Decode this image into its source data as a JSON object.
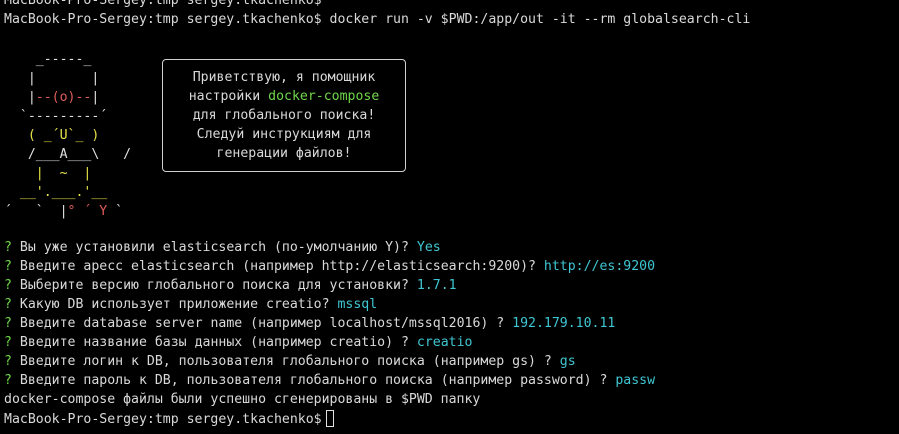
{
  "terminal": {
    "top_prompt": "MacBook-Pro-Sergey:tmp sergey.tkachenko$",
    "command_prompt": "MacBook-Pro-Sergey:tmp sergey.tkachenko$ ",
    "command": "docker run -v $PWD:/app/out -it --rm globalsearch-cli",
    "ascii_art": {
      "line1": "    _-----_",
      "line2a": "   |       |",
      "line3a": "   |",
      "line3b": "--(o)--",
      "line3c": "|",
      "line4": "  `---------´",
      "line5a": "   ",
      "line5b": "( _´U`_ )",
      "line6": "   /___A___\\   /",
      "line7a": "    ",
      "line7b": "|  ~  |",
      "line8a": "  __'.___.'__",
      "line9a": "´   `  |",
      "line9b": "° ´ Y",
      "line9c": " `"
    },
    "bubble": {
      "line1": "Приветствую, я помощник",
      "line2_prefix": "настройки ",
      "line2_highlight": "docker-compose",
      "line3": "для глобального поиска!",
      "line4": "Следуй инструкциям для",
      "line5": "генерации файлов!"
    },
    "qmark": "?",
    "questions": [
      {
        "text": " Вы уже установили elasticsearch (по-умолчанию Y)? ",
        "answer": "Yes"
      },
      {
        "text": " Введите apecc elasticsearch (например http://elasticsearch:9200)? ",
        "answer": "http://es:9200"
      },
      {
        "text": " Выберите версию глобального поиска для установки? ",
        "answer": "1.7.1"
      },
      {
        "text": " Какую DB использует приложение creatio? ",
        "answer": "mssql"
      },
      {
        "text": " Введите database server name (например localhost/mssql2016) ? ",
        "answer": "192.179.10.11"
      },
      {
        "text": " Введите название базы данных (например creatio) ? ",
        "answer": "creatio"
      },
      {
        "text": " Введите логин к DB, пользователя глобального поиска (например gs) ? ",
        "answer": "gs"
      },
      {
        "text": " Введите пароль к DB, пользователя глобального поиска (например password) ? ",
        "answer": "passw"
      }
    ],
    "success_message": "docker-compose файлы были успешно сгенерированы в $PWD папку",
    "final_prompt": "MacBook-Pro-Sergey:tmp sergey.tkachenko$",
    "colors": {
      "background": "#000000",
      "text": "#d9d9d9",
      "question_mark": "#6fd64a",
      "answer": "#3fc6d2",
      "highlight": "#6fd64a",
      "mascot_red": "#e05c5c",
      "mascot_yellow": "#e8e44a"
    }
  }
}
